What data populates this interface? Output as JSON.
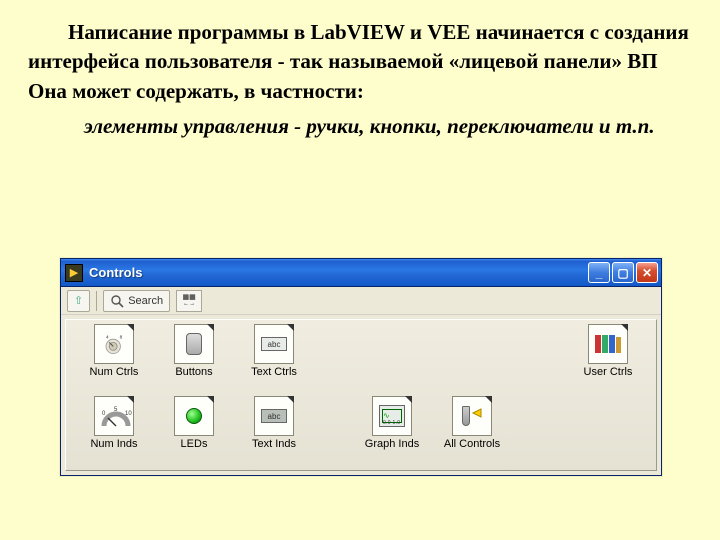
{
  "text": {
    "para1": "Написание программы в LabVIEW и VEE начинается с создания интерфейса пользователя - так называемой «лицевой панели» ВП Она может содержать, в частности:",
    "para2": "элементы управления - ручки, кнопки, переключатели  и т.п."
  },
  "window": {
    "title": "Controls",
    "buttons": {
      "minimize": "_",
      "maximize": "▢",
      "close": "✕"
    },
    "toolbar": {
      "up_icon": "⇧",
      "search_label": "Search",
      "view_icon": "▦"
    },
    "palette": {
      "row1": [
        {
          "label": "Num Ctrls",
          "kind": "knob"
        },
        {
          "label": "Buttons",
          "kind": "button3d"
        },
        {
          "label": "Text Ctrls",
          "kind": "textctrl"
        },
        {
          "label": "User Ctrls",
          "kind": "user"
        }
      ],
      "row2": [
        {
          "label": "Num Inds",
          "kind": "dial"
        },
        {
          "label": "LEDs",
          "kind": "led"
        },
        {
          "label": "Text Inds",
          "kind": "textind"
        },
        {
          "label": "Graph Inds",
          "kind": "graph"
        },
        {
          "label": "All Controls",
          "kind": "tools"
        }
      ]
    }
  }
}
